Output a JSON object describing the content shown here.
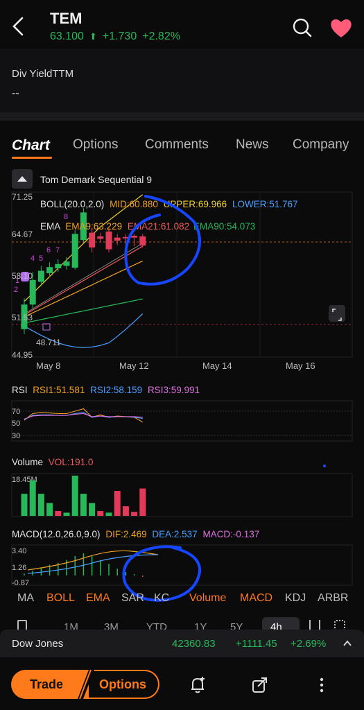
{
  "header": {
    "ticker": "TEM",
    "price": "63.100",
    "change": "+1.730",
    "change_pct": "+2.82%"
  },
  "stats": {
    "div_yield_label": "Div YieldTTM",
    "div_yield_value": "--"
  },
  "tabs": [
    "Chart",
    "Options",
    "Comments",
    "News",
    "Company"
  ],
  "indicator_name": "Tom Demark Sequential 9",
  "boll": {
    "label": "BOLL(20.0,2.0)",
    "mid": "MID:60.880",
    "upper": "UPPER:69.966",
    "lower": "LOWER:51.767"
  },
  "ema": {
    "label": "EMA",
    "ema9": "EMA9:63.229",
    "ema21": "EMA21:61.082",
    "ema90": "EMA90:54.073"
  },
  "rsi": {
    "label": "RSI",
    "rsi1": "RSI1:51.581",
    "rsi2": "RSI2:58.159",
    "rsi3": "RSI3:59.991"
  },
  "volume": {
    "label": "Volume",
    "vol": "VOL:191.0",
    "max_tick": "18.45M"
  },
  "macd": {
    "label": "MACD(12.0,26.0,9.0)",
    "dif": "DIF:2.469",
    "dea": "DEA:2.537",
    "macd": "MACD:-0.137"
  },
  "chart_data": {
    "type": "candlestick",
    "price_axis": [
      "71.25",
      "64.67",
      "58.10",
      "51.53",
      "44.95"
    ],
    "low_marker": "48.711",
    "date_labels": [
      "May 8",
      "May 12",
      "May 14",
      "May 16"
    ],
    "rsi_ticks": [
      "70",
      "50",
      "30"
    ],
    "macd_ticks": [
      "3.40",
      "1.26",
      "-0.87"
    ],
    "candles": [
      {
        "o": 49.5,
        "c": 53.5,
        "h": 54.5,
        "l": 48.7,
        "up": true
      },
      {
        "o": 53.5,
        "c": 57.5,
        "h": 58.8,
        "l": 52.8,
        "up": true
      },
      {
        "o": 57.2,
        "c": 59.0,
        "h": 59.8,
        "l": 56.5,
        "up": true
      },
      {
        "o": 58.6,
        "c": 59.6,
        "h": 60.4,
        "l": 58.0,
        "up": true
      },
      {
        "o": 59.4,
        "c": 60.1,
        "h": 60.9,
        "l": 58.8,
        "up": true
      },
      {
        "o": 59.8,
        "c": 60.5,
        "h": 61.2,
        "l": 59.2,
        "up": true
      },
      {
        "o": 59.5,
        "c": 65.0,
        "h": 65.6,
        "l": 59.2,
        "up": true
      },
      {
        "o": 64.0,
        "c": 68.5,
        "h": 69.2,
        "l": 63.5,
        "up": true
      },
      {
        "o": 65.2,
        "c": 62.8,
        "h": 66.0,
        "l": 62.0,
        "up": false
      },
      {
        "o": 64.6,
        "c": 64.2,
        "h": 65.2,
        "l": 63.6,
        "up": false
      },
      {
        "o": 65.4,
        "c": 62.5,
        "h": 66.0,
        "l": 62.0,
        "up": false
      },
      {
        "o": 64.4,
        "c": 63.9,
        "h": 65.0,
        "l": 63.2,
        "up": false
      },
      {
        "o": 64.5,
        "c": 64.3,
        "h": 64.9,
        "l": 62.0,
        "up": false
      },
      {
        "o": 64.7,
        "c": 64.4,
        "h": 65.0,
        "l": 63.0,
        "up": false
      },
      {
        "o": 64.6,
        "c": 63.1,
        "h": 65.0,
        "l": 62.8,
        "up": false
      }
    ],
    "volume_bars": [
      {
        "v": 0.55,
        "up": true
      },
      {
        "v": 0.88,
        "up": true
      },
      {
        "v": 0.55,
        "up": true
      },
      {
        "v": 0.32,
        "up": true
      },
      {
        "v": 0.12,
        "up": false
      },
      {
        "v": 0.08,
        "up": true
      },
      {
        "v": 1.0,
        "up": true
      },
      {
        "v": 0.55,
        "up": true
      },
      {
        "v": 0.32,
        "up": true
      },
      {
        "v": 0.12,
        "up": false
      },
      {
        "v": 0.08,
        "up": true
      },
      {
        "v": 0.62,
        "up": false
      },
      {
        "v": 0.24,
        "up": false
      },
      {
        "v": 0.1,
        "up": false
      },
      {
        "v": 0.68,
        "up": false
      }
    ],
    "macd_hist": [
      0.2,
      0.5,
      0.8,
      1.1,
      1.3,
      1.6,
      2.0,
      2.3,
      2.0,
      1.6,
      1.2,
      0.7,
      0.35,
      0.15,
      -0.14
    ]
  },
  "indicator_tabs": [
    "MA",
    "BOLL",
    "EMA",
    "SAR",
    "KC",
    "Volume",
    "MACD",
    "KDJ",
    "ARBR"
  ],
  "indicator_tabs_on": [
    "BOLL",
    "EMA",
    "Volume",
    "MACD"
  ],
  "ranges": [
    "1M",
    "3M",
    "YTD",
    "1Y",
    "5Y",
    "4h"
  ],
  "dow": {
    "name": "Dow Jones",
    "price": "42360.83",
    "change": "+1111.45",
    "pct": "+2.69%"
  },
  "bottom": {
    "trade": "Trade",
    "options": "Options"
  },
  "colors": {
    "up": "#27b85a",
    "down": "#e23b5a",
    "accent": "#ff7a1a",
    "annotation": "#1646ff"
  }
}
